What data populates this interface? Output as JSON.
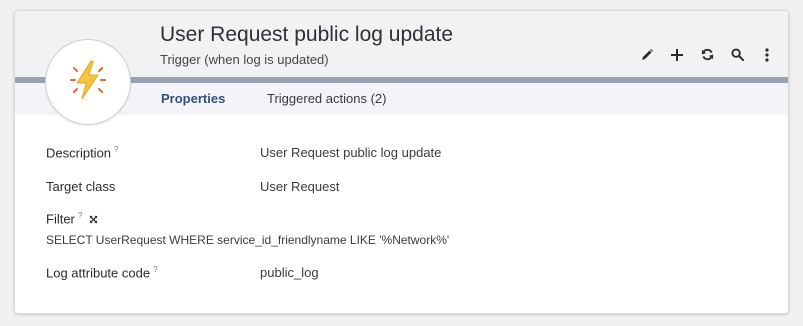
{
  "header": {
    "title": "User Request public log update",
    "subtitle": "Trigger (when log is updated)",
    "icon": "lightning-bolt-icon",
    "accent_color": "#f6c343",
    "bar_color": "#97a3b4"
  },
  "toolbar": [
    {
      "name": "edit-button",
      "icon": "pencil-icon"
    },
    {
      "name": "new-button",
      "icon": "plus-icon"
    },
    {
      "name": "refresh-button",
      "icon": "refresh-icon"
    },
    {
      "name": "search-button",
      "icon": "search-icon"
    },
    {
      "name": "more-button",
      "icon": "vertical-dots-icon"
    }
  ],
  "tabs": [
    {
      "label": "Properties",
      "active": true
    },
    {
      "label": "Triggered actions (2)",
      "active": false
    }
  ],
  "fields": {
    "description": {
      "label": "Description",
      "help": "?",
      "value": "User Request public log update"
    },
    "target_class": {
      "label": "Target class",
      "value": "User Request"
    },
    "filter": {
      "label": "Filter",
      "help": "?",
      "value": "SELECT UserRequest WHERE service_id_friendlyname LIKE '%Network%'"
    },
    "log_attribute_code": {
      "label": "Log attribute code",
      "help": "?",
      "value": "public_log"
    }
  }
}
